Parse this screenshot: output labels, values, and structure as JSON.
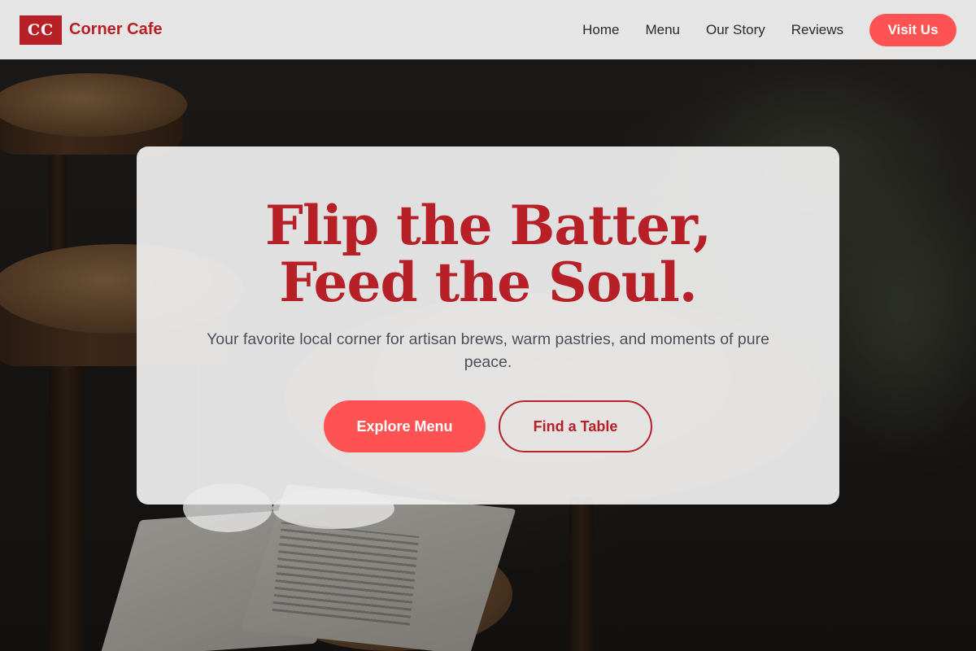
{
  "header": {
    "logo_text": "CC",
    "brand_name": "Corner Cafe",
    "nav": [
      {
        "label": "Home"
      },
      {
        "label": "Menu"
      },
      {
        "label": "Our Story"
      },
      {
        "label": "Reviews"
      }
    ],
    "cta_label": "Visit Us"
  },
  "hero": {
    "title_line1": "Flip the Batter,",
    "title_line2": "Feed the Soul.",
    "subtitle": "Your favorite local corner for artisan brews, warm pastries, and moments of pure peace.",
    "primary_button": "Explore Menu",
    "secondary_button": "Find a Table",
    "background_image": "cafe-interior-photo"
  },
  "colors": {
    "brand_red": "#b72026",
    "accent_coral": "#ff5252",
    "header_bg": "#ececec",
    "card_bg": "#f0f0f0"
  }
}
